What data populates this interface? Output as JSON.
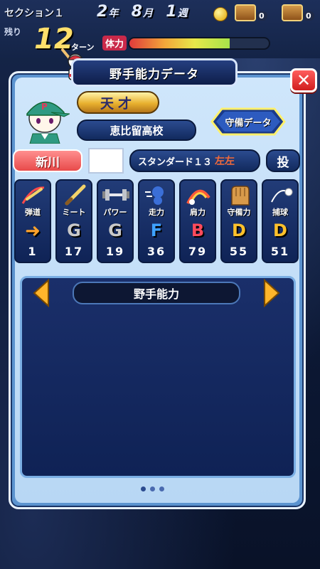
{
  "hud": {
    "section": "セクション１",
    "remaining_label": "残り",
    "turns": "12",
    "turn_label": "ターン",
    "year": "2",
    "year_unit": "年",
    "month": "8",
    "month_unit": "月",
    "week": "1",
    "week_unit": "週",
    "chest1_count": "0",
    "chest2_count": "0",
    "stamina_label": "体力",
    "stamina_level": 0.72
  },
  "panel": {
    "title": "野手能力データ",
    "rank": "天才",
    "school": "恵比留高校",
    "defense_button": "守備データ",
    "player_name": "新川",
    "standard_label": "スタンダード１３",
    "hand_glyph": "左左",
    "position": "投"
  },
  "stats": [
    {
      "key": "trajectory",
      "label": "弾道",
      "icon": "trajectory-icon",
      "grade": "➜",
      "value": "1",
      "grade_color": "#ffa32b"
    },
    {
      "key": "meet",
      "label": "ミート",
      "icon": "bat-icon",
      "grade": "G",
      "value": "17",
      "grade_color": "#c9c9c9"
    },
    {
      "key": "power",
      "label": "パワー",
      "icon": "dumbbell-icon",
      "grade": "G",
      "value": "19",
      "grade_color": "#c9c9c9"
    },
    {
      "key": "speed",
      "label": "走力",
      "icon": "runner-icon",
      "grade": "F",
      "value": "36",
      "grade_color": "#3ea2ff"
    },
    {
      "key": "arm",
      "label": "肩力",
      "icon": "arc-ball-icon",
      "grade": "B",
      "value": "79",
      "grade_color": "#ff4b5c"
    },
    {
      "key": "fielding",
      "label": "守備力",
      "icon": "glove-icon",
      "grade": "D",
      "value": "55",
      "grade_color": "#ffc12b"
    },
    {
      "key": "catching",
      "label": "捕球",
      "icon": "catch-icon",
      "grade": "D",
      "value": "51",
      "grade_color": "#ffc12b"
    }
  ],
  "ability": {
    "title": "野手能力"
  },
  "colors": {
    "panel_border": "#5b93cf",
    "close_button": "#e02a2a",
    "name_plate": "#ef5a5a"
  }
}
